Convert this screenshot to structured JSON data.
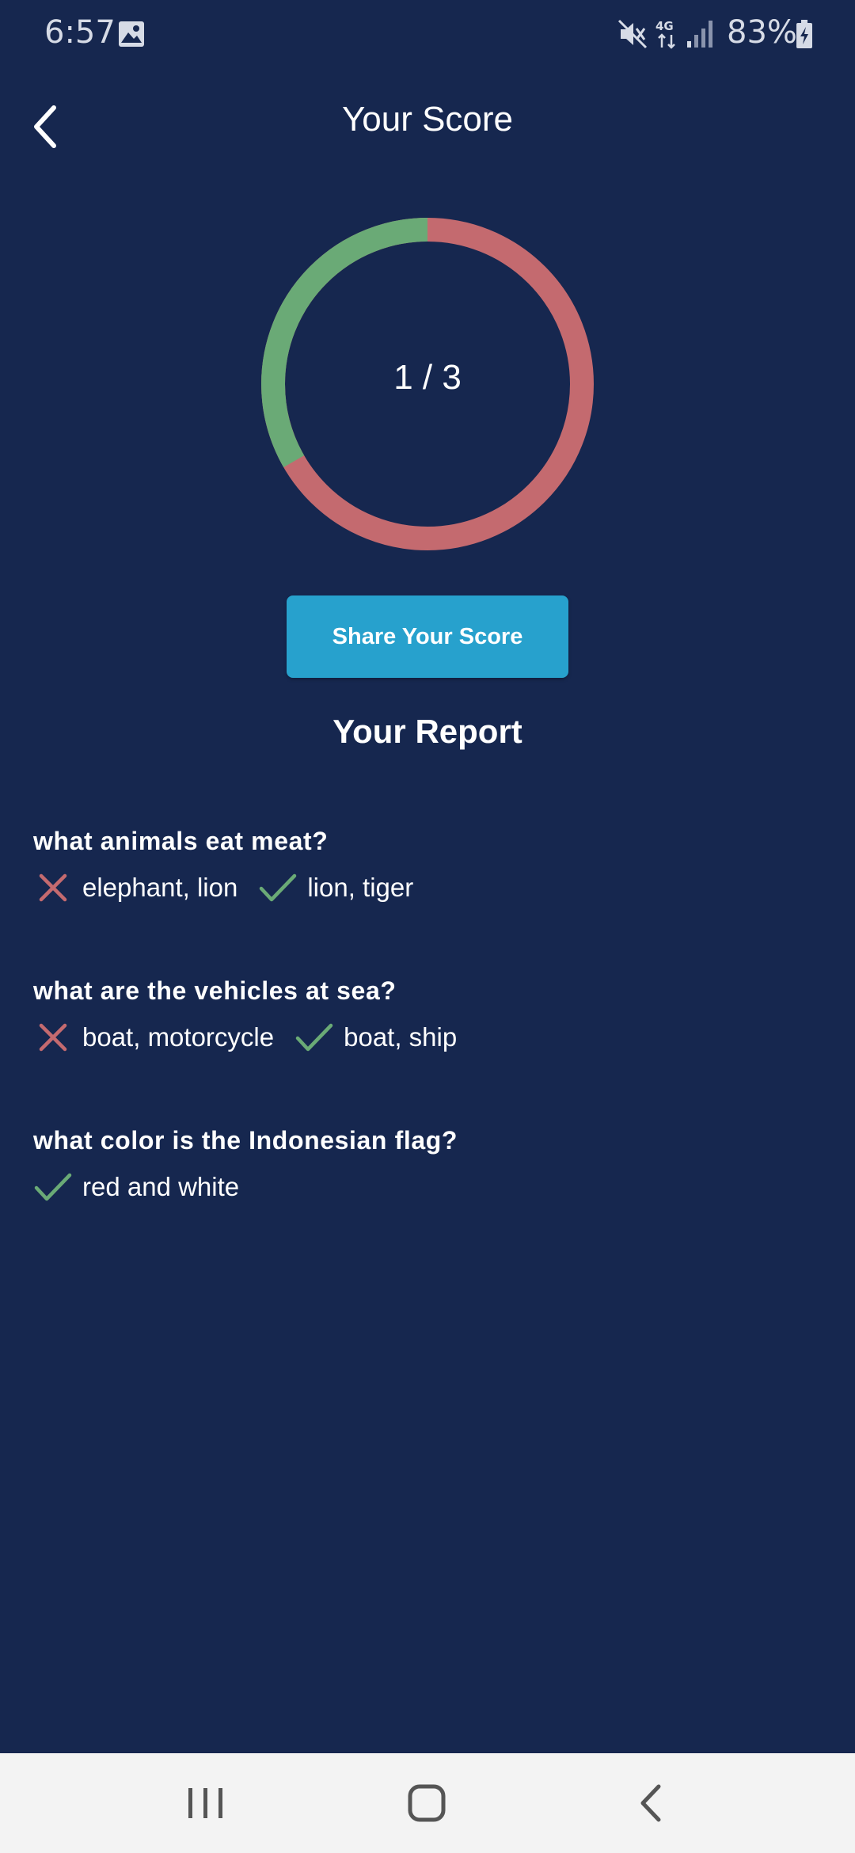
{
  "status_bar": {
    "time": "6:57",
    "battery": "83%",
    "network": "4G"
  },
  "header": {
    "title": "Your Score"
  },
  "score": {
    "text": "1 / 3",
    "correct": 1,
    "total": 3,
    "correct_color": "#6aaa76",
    "incorrect_color": "#c46a6f"
  },
  "share_button": {
    "label": "Share Your Score",
    "color": "#27a1cd"
  },
  "report": {
    "title": "Your Report",
    "items": [
      {
        "question": "what animals eat meat?",
        "answers": [
          {
            "status": "incorrect",
            "icon": "cross-icon",
            "text": "elephant, lion"
          },
          {
            "status": "correct",
            "icon": "check-icon",
            "text": "lion, tiger"
          }
        ]
      },
      {
        "question": "what are the vehicles at sea?",
        "answers": [
          {
            "status": "incorrect",
            "icon": "cross-icon",
            "text": "boat, motorcycle"
          },
          {
            "status": "correct",
            "icon": "check-icon",
            "text": "boat, ship"
          }
        ]
      },
      {
        "question": "what color is the Indonesian flag?",
        "answers": [
          {
            "status": "correct",
            "icon": "check-icon",
            "text": "red and white"
          }
        ]
      }
    ]
  },
  "nav_bar": {
    "recents_icon": "recents-icon",
    "home_icon": "home-icon",
    "back_icon": "back-icon"
  }
}
